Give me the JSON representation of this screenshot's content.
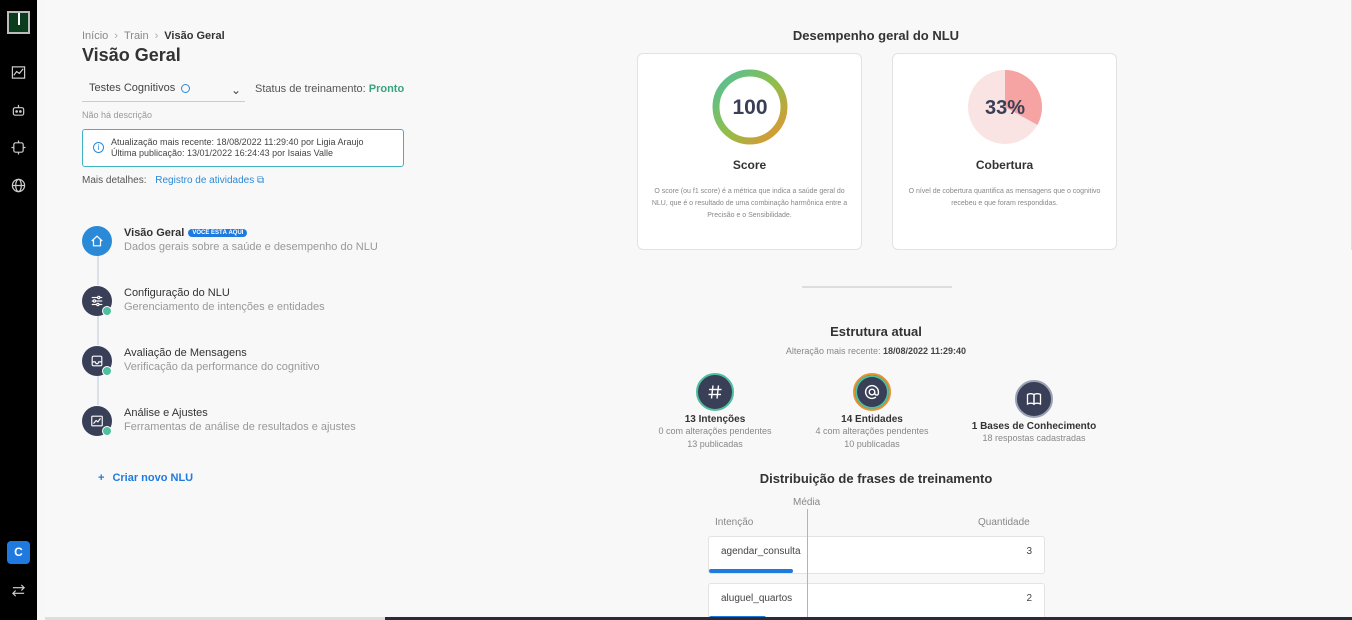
{
  "sidebar": {
    "logo": "app-logo",
    "icons": [
      "chart-icon",
      "robot-icon",
      "integration-icon",
      "globe-icon",
      "swap-icon"
    ],
    "user_initial": "C"
  },
  "breadcrumb": {
    "items": [
      "Início",
      "Train",
      "Visão Geral"
    ]
  },
  "page": {
    "title": "Visão Geral",
    "nlu_select_value": "Testes Cognitivos",
    "status_label": "Status de treinamento:",
    "status_value": "Pronto",
    "no_description": "Não há descrição",
    "update_line_prefix": "Atualização mais recente: 18/08/2022 11:29:40 por ",
    "update_user": "Ligia Araujo",
    "publish_line_prefix": "Última publicação: 13/01/2022 16:24:43 por ",
    "publish_user": "Isaias Valle",
    "more_details_label": "Mais detalhes:",
    "activity_link": "Registro de atividades"
  },
  "steps": [
    {
      "title": "Visão Geral",
      "badge": "VOCÊ ESTÁ AQUI",
      "sub": "Dados gerais sobre a saúde e desempenho do NLU",
      "icon": "home-icon"
    },
    {
      "title": "Configuração do NLU",
      "sub": "Gerenciamento de intenções e entidades",
      "icon": "sliders-icon"
    },
    {
      "title": "Avaliação de Mensagens",
      "sub": "Verificação da performance do cognitivo",
      "icon": "inbox-icon"
    },
    {
      "title": "Análise e Ajustes",
      "sub": "Ferramentas de análise de resultados e ajustes",
      "icon": "chart-icon"
    }
  ],
  "create_nlu": "Criar novo NLU",
  "performance": {
    "title": "Desempenho geral do NLU",
    "score": {
      "value": "100",
      "label": "Score",
      "desc": "O score (ou f1 score) é a métrica que indica a saúde geral do NLU, que é o resultado de uma combinação harmônica entre a Precisão e o Sensibilidade."
    },
    "coverage": {
      "value": "33%",
      "fraction": 0.33,
      "label": "Cobertura",
      "desc": "O nível de cobertura quantifica as mensagens que o cognitivo recebeu e que foram respondidas."
    }
  },
  "structure": {
    "title": "Estrutura atual",
    "recent_label": "Alteração mais recente:",
    "recent_value": "18/08/2022 11:29:40",
    "items": [
      {
        "title": "13 Intenções",
        "line1": "0 com alterações pendentes",
        "line2": "13 publicadas",
        "icon": "hash-icon"
      },
      {
        "title": "14 Entidades",
        "line1": "4 com alterações pendentes",
        "line2": "10 publicadas",
        "icon": "at-icon"
      },
      {
        "title": "1 Bases de Conhecimento",
        "line1": "18 respostas cadastradas",
        "icon": "book-icon"
      }
    ]
  },
  "distribution": {
    "title": "Distribuição de frases de treinamento",
    "media_label": "Média",
    "col_intent": "Intenção",
    "col_qty": "Quantidade",
    "rows": [
      {
        "name": "agendar_consulta",
        "qty": "3",
        "fraction": 0.25
      },
      {
        "name": "aluguel_quartos",
        "qty": "2",
        "fraction": 0.17
      }
    ]
  },
  "colors": {
    "accent": "#1f7ae0",
    "success": "#3aa37f",
    "dark_circle": "#3a3f58",
    "coverage": "#f5a3a3"
  }
}
